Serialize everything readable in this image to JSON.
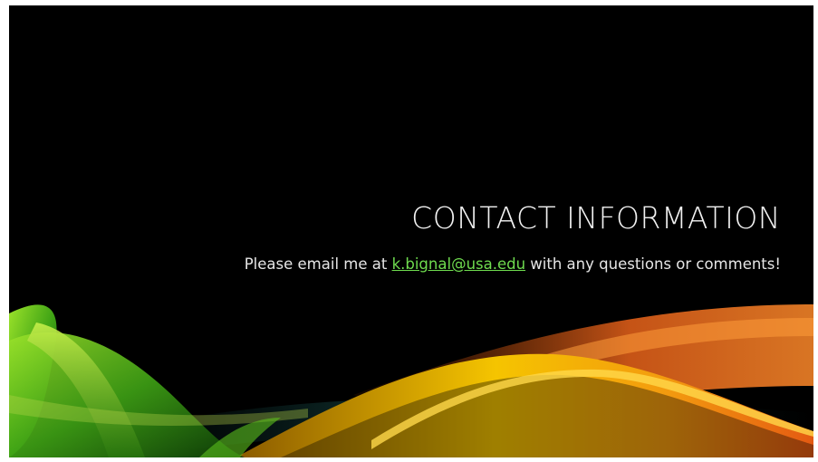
{
  "slide": {
    "title": "CONTACT INFORMATION",
    "body_prefix": "Please email me at ",
    "email_link": "k.bignal@usa.edu",
    "body_suffix": " with any questions or comments!"
  },
  "colors": {
    "background": "#000000",
    "title": "#f2f2f2",
    "link": "#6fdc4f",
    "wave_green": "#5bbf1c",
    "wave_yellow": "#f2b705",
    "wave_orange": "#e8621a"
  }
}
